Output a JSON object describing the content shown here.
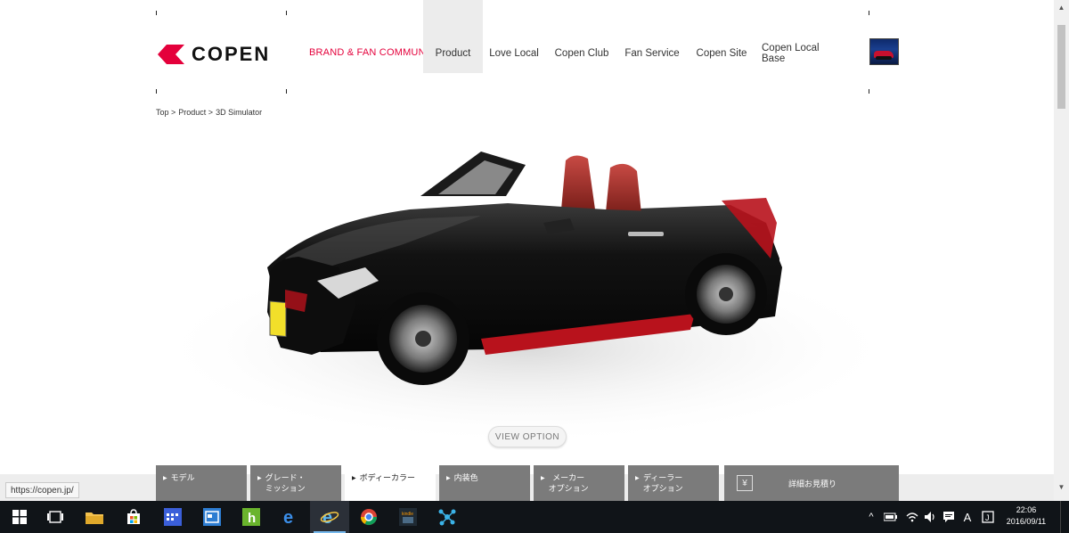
{
  "header": {
    "logo_text": "COPEN",
    "brand_label": "BRAND & FAN COMMUNITY",
    "nav": [
      {
        "label": "Product",
        "active": true
      },
      {
        "label": "Love Local",
        "active": false
      },
      {
        "label": "Copen Club",
        "active": false
      },
      {
        "label": "Fan Service",
        "active": false
      },
      {
        "label": "Copen Site",
        "active": false
      },
      {
        "label": "Copen Local Base",
        "active": false
      }
    ]
  },
  "breadcrumb": [
    "Top >",
    "Product >",
    "3D Simulator"
  ],
  "simulator": {
    "view_option_label": "VIEW OPTION",
    "body_color": "#0b0b0b",
    "accent_color": "#b8121c"
  },
  "tabs": [
    {
      "label": "モデル",
      "active": false
    },
    {
      "label": "グレード・\nミッション",
      "active": false
    },
    {
      "label": "ボディーカラー",
      "active": true
    },
    {
      "label": "内装色",
      "active": false
    },
    {
      "label": "メーカー\nオプション",
      "active": false
    },
    {
      "label": "ディーラー\nオプション",
      "active": false
    }
  ],
  "estimate": {
    "icon": "yen-icon",
    "label": "詳細お見積り"
  },
  "status_url": "https://copen.jp/",
  "taskbar": {
    "apps": [
      "start-icon",
      "task-view-icon",
      "file-explorer-icon",
      "store-icon",
      "calendar-app-icon",
      "news-app-icon",
      "hulu-icon",
      "edge-icon",
      "internet-explorer-icon",
      "chrome-icon",
      "kindle-icon",
      "network-app-icon"
    ],
    "ime_label": "A",
    "time": "22:06",
    "date": "2016/09/11"
  },
  "colors": {
    "brand_red": "#e4003b",
    "tab_gray": "#7b7b7b",
    "taskbar": "#101418"
  }
}
